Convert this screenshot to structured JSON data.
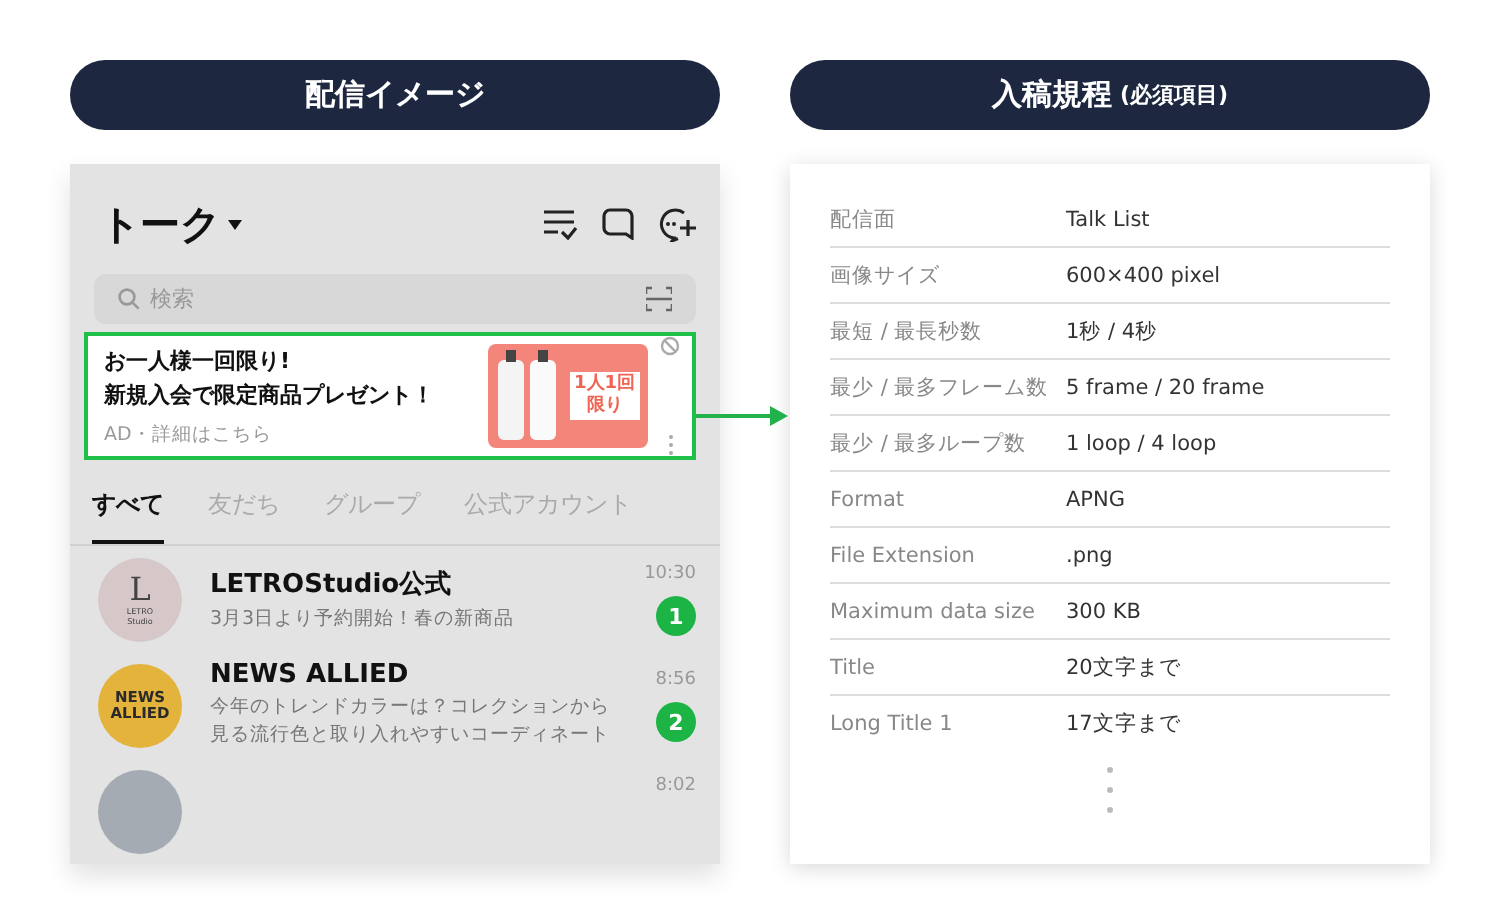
{
  "preview": {
    "heading": "配信イメージ",
    "screen_title": "トーク",
    "search": {
      "placeholder": "検索"
    },
    "ad": {
      "lines": [
        "お一人様一回限り!",
        "新規入会で限定商品プレゼント！"
      ],
      "meta": "AD・詳細はこちら",
      "image_text": [
        "1人1回",
        "限り"
      ]
    },
    "tabs": [
      {
        "label": "すべて",
        "selected": true
      },
      {
        "label": "友だち",
        "selected": false
      },
      {
        "label": "グループ",
        "selected": false
      },
      {
        "label": "公式アカウント",
        "selected": false
      }
    ],
    "chats": [
      {
        "avatar": {
          "kind": "letter",
          "big": "L",
          "small": "LETRO Studio"
        },
        "name": "LETROStudio公式",
        "messages": [
          "3月3日より予約開始！春の新商品"
        ],
        "time": "10:30",
        "unread": "1"
      },
      {
        "avatar": {
          "kind": "news",
          "lines": [
            "NEWS",
            "ALLIED"
          ]
        },
        "name": "NEWS ALLIED",
        "messages": [
          "今年のトレンドカラーは？コレクションから",
          "見る流行色と取り入れやすいコーディネート"
        ],
        "time": "8:56",
        "unread": "2"
      },
      {
        "avatar": {
          "kind": "photo"
        },
        "time": "8:02"
      }
    ]
  },
  "spec": {
    "heading": "入稿規程",
    "heading_note": "(必須項目)",
    "rows": [
      {
        "label": "配信面",
        "value": "Talk List"
      },
      {
        "label": "画像サイズ",
        "value": "600×400 pixel"
      },
      {
        "label": "最短 / 最長秒数",
        "value": "1秒 / 4秒"
      },
      {
        "label": "最少 / 最多フレーム数",
        "value": "5 frame / 20 frame"
      },
      {
        "label": "最少 / 最多ループ数",
        "value": "1 loop / 4 loop"
      },
      {
        "label": "Format",
        "value": "APNG"
      },
      {
        "label": "File Extension",
        "value": ".png"
      },
      {
        "label": "Maximum data size",
        "value": "300 KB"
      },
      {
        "label": "Title",
        "value": "20文字まで"
      },
      {
        "label": "Long Title 1",
        "value": "17文字まで"
      }
    ]
  }
}
